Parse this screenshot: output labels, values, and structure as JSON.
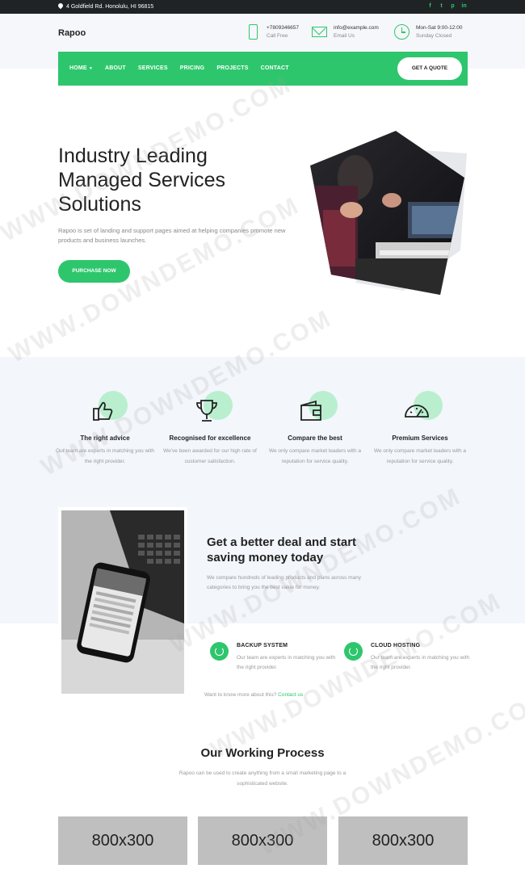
{
  "topbar": {
    "address": "4 Goldfield Rd. Honolulu, HI 96815",
    "social": [
      {
        "name": "facebook-icon",
        "glyph": "f"
      },
      {
        "name": "twitter-icon",
        "glyph": "t"
      },
      {
        "name": "pinterest-icon",
        "glyph": "p"
      },
      {
        "name": "linkedin-icon",
        "glyph": "in"
      }
    ]
  },
  "header": {
    "logo": "Rapoo",
    "phone": {
      "value": "+7809346657",
      "label": "Call Free"
    },
    "email": {
      "value": "info@example.com",
      "label": "Email Us"
    },
    "hours": {
      "value": "Mon-Sat 9:00-12:00",
      "label": "Sunday Closed"
    }
  },
  "nav": {
    "items": [
      "HOME",
      "ABOUT",
      "SERVICES",
      "PRICING",
      "PROJECTS",
      "CONTACT"
    ],
    "cta": "GET A QUOTE"
  },
  "hero": {
    "title": "Industry Leading Managed Services Solutions",
    "description": "Rapoo is set of landing and support pages aimed at helping companies promote new products and business launches.",
    "button": "PURCHASE NOW"
  },
  "features": [
    {
      "icon": "thumbs-up-icon",
      "title": "The right advice",
      "text": "Our team are experts in matching you with the right provider."
    },
    {
      "icon": "trophy-icon",
      "title": "Recognised for excellence",
      "text": "We've been awarded for our high rate of customer satisfaction."
    },
    {
      "icon": "wallet-icon",
      "title": "Compare the best",
      "text": "We only compare market leaders with a reputation for service quality."
    },
    {
      "icon": "speedometer-icon",
      "title": "Premium Services",
      "text": "We only compare market leaders with a reputation for service quality."
    }
  ],
  "deal": {
    "title": "Get a better deal and start saving money today",
    "description": "We compare hundreds of leading products and plans across many categories to bring you the best value for money.",
    "services": [
      {
        "title": "BACKUP SYSTEM",
        "text": "Our team are experts in matching you with the right provider."
      },
      {
        "title": "CLOUD HOSTING",
        "text": "Our team are experts in matching you with the right provider."
      }
    ],
    "contact_prefix": "Want to know more about this?",
    "contact_link": "Contact us"
  },
  "process": {
    "title": "Our Working Process",
    "description": "Rapoo can be used to create anything from a small marketing page to a sophisticated website.",
    "placeholders": [
      "800x300",
      "800x300",
      "800x300"
    ]
  },
  "watermark": "WWW.DOWNDEMO.COM",
  "colors": {
    "accent": "#2ec66d",
    "dark": "#1f2326",
    "light_bg": "#f3f6fa"
  }
}
